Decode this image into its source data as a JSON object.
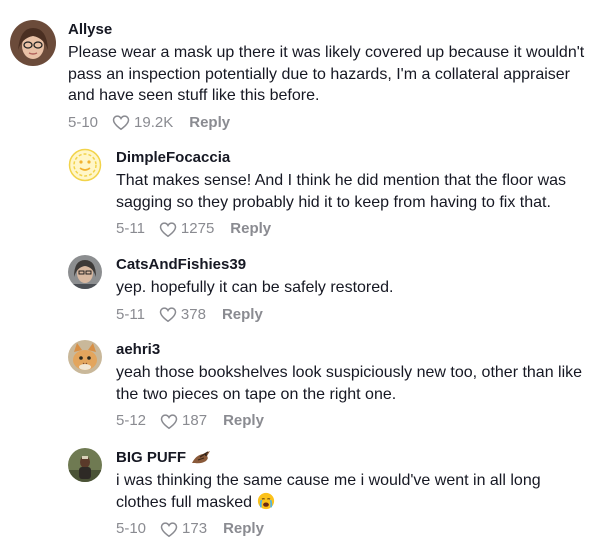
{
  "comments": [
    {
      "username": "Allyse",
      "text": "Please wear a mask up there it was likely covered up because it wouldn't pass an inspection potentially due to hazards, I'm a collateral appraiser and have seen stuff like this before.",
      "date": "5-10",
      "likes": "19.2K",
      "reply_label": "Reply"
    },
    {
      "username": "DimpleFocaccia",
      "text": "That makes sense! And I think he did mention that the floor was sagging so they probably hid it to keep from having to fix that.",
      "date": "5-11",
      "likes": "1275",
      "reply_label": "Reply"
    },
    {
      "username": "CatsAndFishies39",
      "text": "yep. hopefully it can be safely restored.",
      "date": "5-11",
      "likes": "378",
      "reply_label": "Reply"
    },
    {
      "username": "aehri3",
      "text": "yeah those bookshelves look suspiciously new too, other than like the two pieces on tape on the right one.",
      "date": "5-12",
      "likes": "187",
      "reply_label": "Reply"
    },
    {
      "username": "BIG PUFF",
      "text": "i was thinking the same cause me i would've went in all long clothes full masked",
      "date": "5-10",
      "likes": "173",
      "reply_label": "Reply"
    }
  ],
  "icons": {
    "like": "heart-outline-icon",
    "badge": "bird-icon",
    "emoji": "crying-face-emoji"
  },
  "colors": {
    "text": "#161823",
    "meta": "#8a8b91"
  }
}
